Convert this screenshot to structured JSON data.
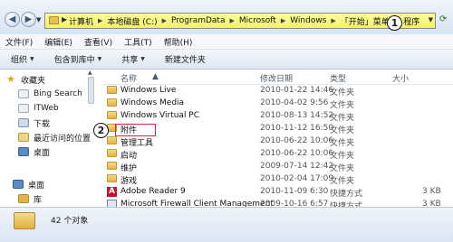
{
  "address_bar": {
    "crumbs": [
      "计算机",
      "本地磁盘 (C:)",
      "ProgramData",
      "Microsoft",
      "Windows",
      "「开始」菜单",
      "程序"
    ],
    "callout": "1"
  },
  "menu": [
    "文件(F)",
    "编辑(E)",
    "查看(V)",
    "工具(T)",
    "帮助(H)"
  ],
  "toolbar": {
    "organize": "组织",
    "include": "包含到库中",
    "share": "共享",
    "new_folder": "新建文件夹"
  },
  "nav": {
    "favorites": "收藏夹",
    "items": [
      "Bing Search",
      "ITWeb",
      "下载",
      "最近访问的位置",
      "桌面"
    ],
    "desktop": "桌面",
    "library": "库"
  },
  "columns": {
    "name": "名称",
    "date": "修改日期",
    "type": "类型",
    "size": "大小"
  },
  "files": [
    {
      "name": "Windows Live",
      "date": "2010-01-22 14:46",
      "type": "文件夹",
      "size": ""
    },
    {
      "name": "Windows Media",
      "date": "2010-04-02 9:56",
      "type": "文件夹",
      "size": ""
    },
    {
      "name": "Windows Virtual PC",
      "date": "2010-08-13 14:52",
      "type": "文件夹",
      "size": ""
    },
    {
      "name": "附件",
      "date": "2010-11-12 16:50",
      "type": "文件夹",
      "size": ""
    },
    {
      "name": "管理工具",
      "date": "2010-06-22 10:06",
      "type": "文件夹",
      "size": ""
    },
    {
      "name": "启动",
      "date": "2010-06-22 10:06",
      "type": "文件夹",
      "size": ""
    },
    {
      "name": "维护",
      "date": "2009-07-14 12:42",
      "type": "文件夹",
      "size": ""
    },
    {
      "name": "游戏",
      "date": "2010-02-04 17:09",
      "type": "文件夹",
      "size": ""
    },
    {
      "name": "Adobe Reader 9",
      "date": "2010-11-09 6:30",
      "type": "快捷方式",
      "size": "3 KB"
    },
    {
      "name": "Microsoft Firewall Client Management",
      "date": "2009-10-16 6:57",
      "type": "快捷方式",
      "size": "3 KB"
    }
  ],
  "selected_callout": "2",
  "status": {
    "count_text": "42 个对象"
  },
  "colors": {
    "address_highlight": "#f1f16a",
    "selection_box": "#d4273b",
    "folder": "#e2b443"
  }
}
